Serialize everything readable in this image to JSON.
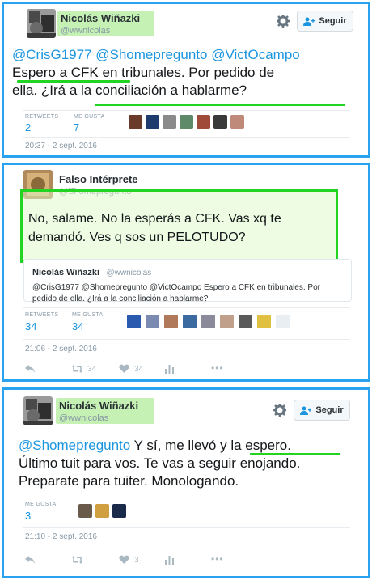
{
  "follow_label": "Seguir",
  "tweet1": {
    "name": "Nicolás Wiñazki",
    "handle": "@wwnicolas",
    "mentions": "@CrisG1977 @Shomepregunto @VictOcampo",
    "text_line2": "Espero a CFK en tribunales. Por pedido de",
    "text_line3": "ella. ¿Irá a la conciliación a hablarme?",
    "retweets_label": "RETWEETS",
    "retweets": "2",
    "likes_label": "ME GUSTA",
    "likes": "7",
    "timestamp": "20:37 - 2 sept. 2016"
  },
  "tweet2": {
    "name": "Falso Intérprete",
    "handle": "@Shomepregunto",
    "text_line1": "No, salame. No la esperás a CFK. Vas xq te",
    "text_line2": "demandó. Ves q sos un PELOTUDO?",
    "quote": {
      "name": "Nicolás Wiñazki",
      "handle": "@wwnicolas",
      "text_line1": "@CrisG1977 @Shomepregunto @VictOcampo Espero a CFK en tribunales. Por",
      "text_line2": "pedido de ella. ¿Irá a la conciliación a hablarme?"
    },
    "retweets_label": "RETWEETS",
    "retweets": "34",
    "likes_label": "ME GUSTA",
    "likes": "34",
    "timestamp": "21:06 - 2 sept. 2016",
    "action_retweet_count": "34",
    "action_like_count": "34",
    "more": "•••"
  },
  "tweet3": {
    "name": "Nicolás Wiñazki",
    "handle": "@wwnicolas",
    "mention": "@Shomepregunto",
    "text_line1_rest": " Y sí, me llevó y la espero.",
    "text_line2": "Último tuit para vos. Te vas a seguir enojando.",
    "text_line3": "Preparate para tuiter. Monologando.",
    "likes_label": "ME GUSTA",
    "likes": "3",
    "timestamp": "21:10 - 2 sept. 2016",
    "action_like_count": "3",
    "more": "•••"
  },
  "colors": {
    "border": "#2aa3ef",
    "link": "#1b95e0",
    "highlight": "#21d421"
  }
}
